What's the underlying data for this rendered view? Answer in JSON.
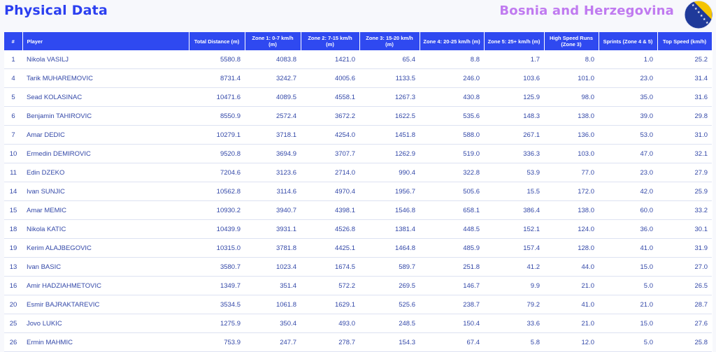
{
  "header": {
    "title": "Physical Data",
    "country": "Bosnia and Herzegovina"
  },
  "colors": {
    "accent": "#2f49f0",
    "title": "#2b3ff0",
    "country": "#c07af0",
    "flag_blue": "#1f3a9a",
    "flag_yellow": "#f5c400"
  },
  "table": {
    "columns": [
      {
        "key": "num",
        "label": "#"
      },
      {
        "key": "player",
        "label": "Player"
      },
      {
        "key": "td",
        "label": "Total Distance (m)"
      },
      {
        "key": "z1",
        "label": "Zone 1: 0-7 km/h (m)"
      },
      {
        "key": "z2",
        "label": "Zone 2: 7-15 km/h (m)"
      },
      {
        "key": "zc",
        "label": "Zone 3: 15-20 km/h (m)"
      },
      {
        "key": "z4",
        "label": "Zone 4: 20-25 km/h (m)"
      },
      {
        "key": "z5",
        "label": "Zone 5: 25+ km/h (m)"
      },
      {
        "key": "z3",
        "label": "High Speed Runs (Zone 3)"
      },
      {
        "key": "sp",
        "label": "Sprints (Zone 4 & 5)"
      },
      {
        "key": "top",
        "label": "Top Speed (km/h)"
      }
    ],
    "rows": [
      [
        "1",
        "Nikola VASILJ",
        "5580.8",
        "4083.8",
        "1421.0",
        "65.4",
        "8.8",
        "1.7",
        "8.0",
        "1.0",
        "25.2"
      ],
      [
        "4",
        "Tarik MUHAREMOVIC",
        "8731.4",
        "3242.7",
        "4005.6",
        "1133.5",
        "246.0",
        "103.6",
        "101.0",
        "23.0",
        "31.4"
      ],
      [
        "5",
        "Sead KOLASINAC",
        "10471.6",
        "4089.5",
        "4558.1",
        "1267.3",
        "430.8",
        "125.9",
        "98.0",
        "35.0",
        "31.6"
      ],
      [
        "6",
        "Benjamin TAHIROVIC",
        "8550.9",
        "2572.4",
        "3672.2",
        "1622.5",
        "535.6",
        "148.3",
        "138.0",
        "39.0",
        "29.8"
      ],
      [
        "7",
        "Amar DEDIC",
        "10279.1",
        "3718.1",
        "4254.0",
        "1451.8",
        "588.0",
        "267.1",
        "136.0",
        "53.0",
        "31.0"
      ],
      [
        "10",
        "Ermedin DEMIROVIC",
        "9520.8",
        "3694.9",
        "3707.7",
        "1262.9",
        "519.0",
        "336.3",
        "103.0",
        "47.0",
        "32.1"
      ],
      [
        "11",
        "Edin DZEKO",
        "7204.6",
        "3123.6",
        "2714.0",
        "990.4",
        "322.8",
        "53.9",
        "77.0",
        "23.0",
        "27.9"
      ],
      [
        "14",
        "Ivan SUNJIC",
        "10562.8",
        "3114.6",
        "4970.4",
        "1956.7",
        "505.6",
        "15.5",
        "172.0",
        "42.0",
        "25.9"
      ],
      [
        "15",
        "Amar MEMIC",
        "10930.2",
        "3940.7",
        "4398.1",
        "1546.8",
        "658.1",
        "386.4",
        "138.0",
        "60.0",
        "33.2"
      ],
      [
        "18",
        "Nikola KATIC",
        "10439.9",
        "3931.1",
        "4526.8",
        "1381.4",
        "448.5",
        "152.1",
        "124.0",
        "36.0",
        "30.1"
      ],
      [
        "19",
        "Kerim ALAJBEGOVIC",
        "10315.0",
        "3781.8",
        "4425.1",
        "1464.8",
        "485.9",
        "157.4",
        "128.0",
        "41.0",
        "31.9"
      ],
      [
        "13",
        "Ivan BASIC",
        "3580.7",
        "1023.4",
        "1674.5",
        "589.7",
        "251.8",
        "41.2",
        "44.0",
        "15.0",
        "27.0"
      ],
      [
        "16",
        "Amir HADZIAHMETOVIC",
        "1349.7",
        "351.4",
        "572.2",
        "269.5",
        "146.7",
        "9.9",
        "21.0",
        "5.0",
        "26.5"
      ],
      [
        "20",
        "Esmir BAJRAKTAREVIC",
        "3534.5",
        "1061.8",
        "1629.1",
        "525.6",
        "238.7",
        "79.2",
        "41.0",
        "21.0",
        "28.7"
      ],
      [
        "25",
        "Jovo LUKIC",
        "1275.9",
        "350.4",
        "493.0",
        "248.5",
        "150.4",
        "33.6",
        "21.0",
        "15.0",
        "27.6"
      ],
      [
        "26",
        "Ermin MAHMIC",
        "753.9",
        "247.7",
        "278.7",
        "154.3",
        "67.4",
        "5.8",
        "12.0",
        "5.0",
        "25.8"
      ]
    ]
  }
}
